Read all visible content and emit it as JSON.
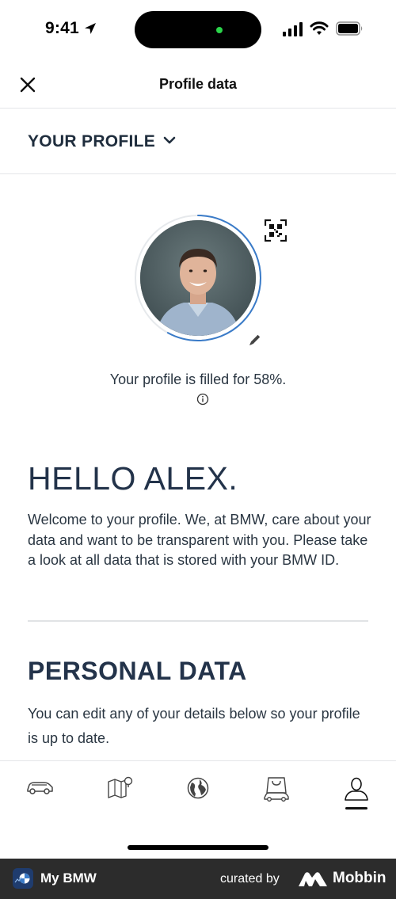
{
  "status_bar": {
    "time": "9:41"
  },
  "header": {
    "title": "Profile data"
  },
  "profile_selector": {
    "label": "YOUR PROFILE"
  },
  "profile": {
    "fill_text": "Your profile is filled for 58%.",
    "fill_fraction": 0.58
  },
  "greeting": {
    "title": "HELLO ALEX.",
    "body": "Welcome to your profile. We, at BMW, care about your data and want to be transparent with you. Please take a look at all data that is stored with your BMW ID."
  },
  "personal_data": {
    "title": "PERSONAL DATA",
    "description": "You can edit any of your details below so your profile is up to date."
  },
  "tabbar": {
    "items": [
      {
        "icon": "car-icon",
        "active": false
      },
      {
        "icon": "map-icon",
        "active": false
      },
      {
        "icon": "globe-icon",
        "active": false
      },
      {
        "icon": "shop-icon",
        "active": false
      },
      {
        "icon": "profile-icon",
        "active": true
      }
    ]
  },
  "footer": {
    "app_name": "My BMW",
    "curated_by": "curated by",
    "brand": "Mobbin"
  },
  "colors": {
    "accent_ring": "#3a7bc8",
    "text_dark": "#23334a",
    "footer_bg": "#2c2c2c"
  }
}
